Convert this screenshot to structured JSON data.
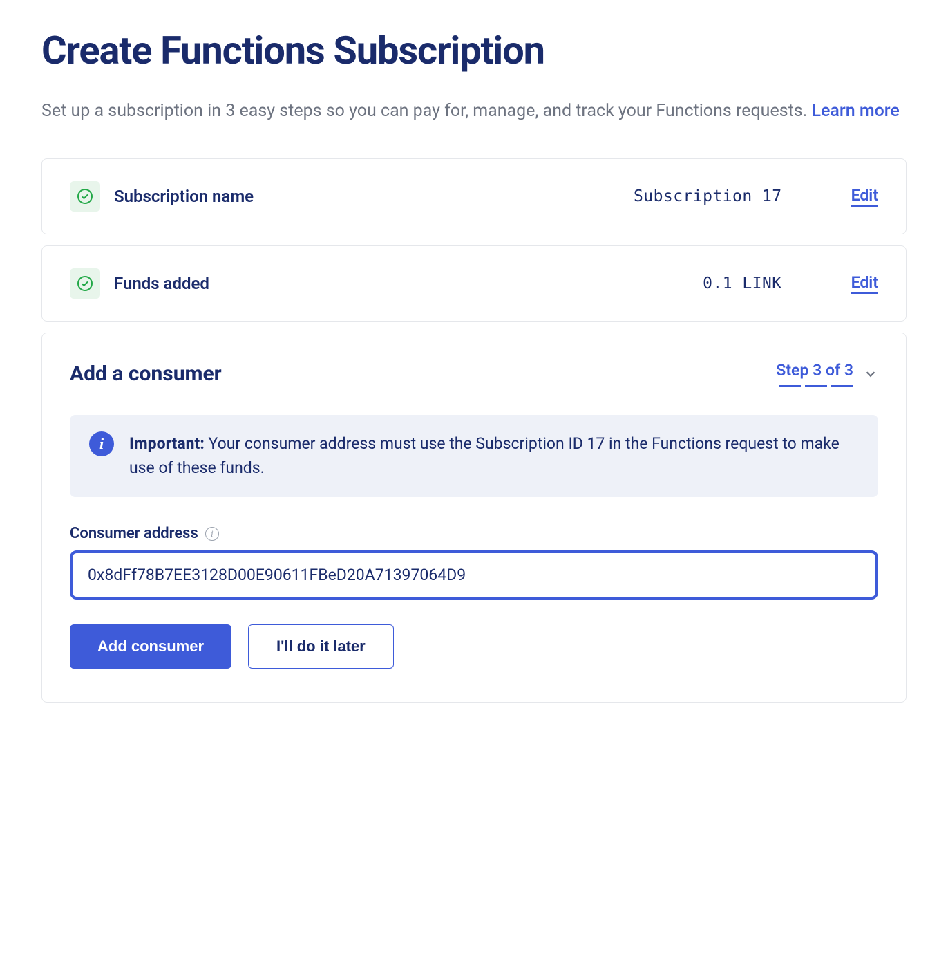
{
  "header": {
    "title": "Create Functions Subscription",
    "description_part1": "Set up a subscription in 3 easy steps so you can pay for, manage, and track your Functions requests. ",
    "learn_more": "Learn more"
  },
  "steps": {
    "subscription_name": {
      "label": "Subscription name",
      "value": "Subscription 17",
      "edit": "Edit"
    },
    "funds_added": {
      "label": "Funds added",
      "value": "0.1 LINK",
      "edit": "Edit"
    }
  },
  "consumer": {
    "title": "Add a consumer",
    "step_indicator": "Step 3 of 3",
    "info_label": "Important:",
    "info_text": " Your consumer address must use the Subscription ID 17 in the Functions request to make use of these funds.",
    "info_icon_char": "i",
    "address_label": "Consumer address",
    "address_value": "0x8dFf78B7EE3128D00E90611FBeD20A71397064D9",
    "add_button": "Add consumer",
    "later_button": "I'll do it later"
  }
}
